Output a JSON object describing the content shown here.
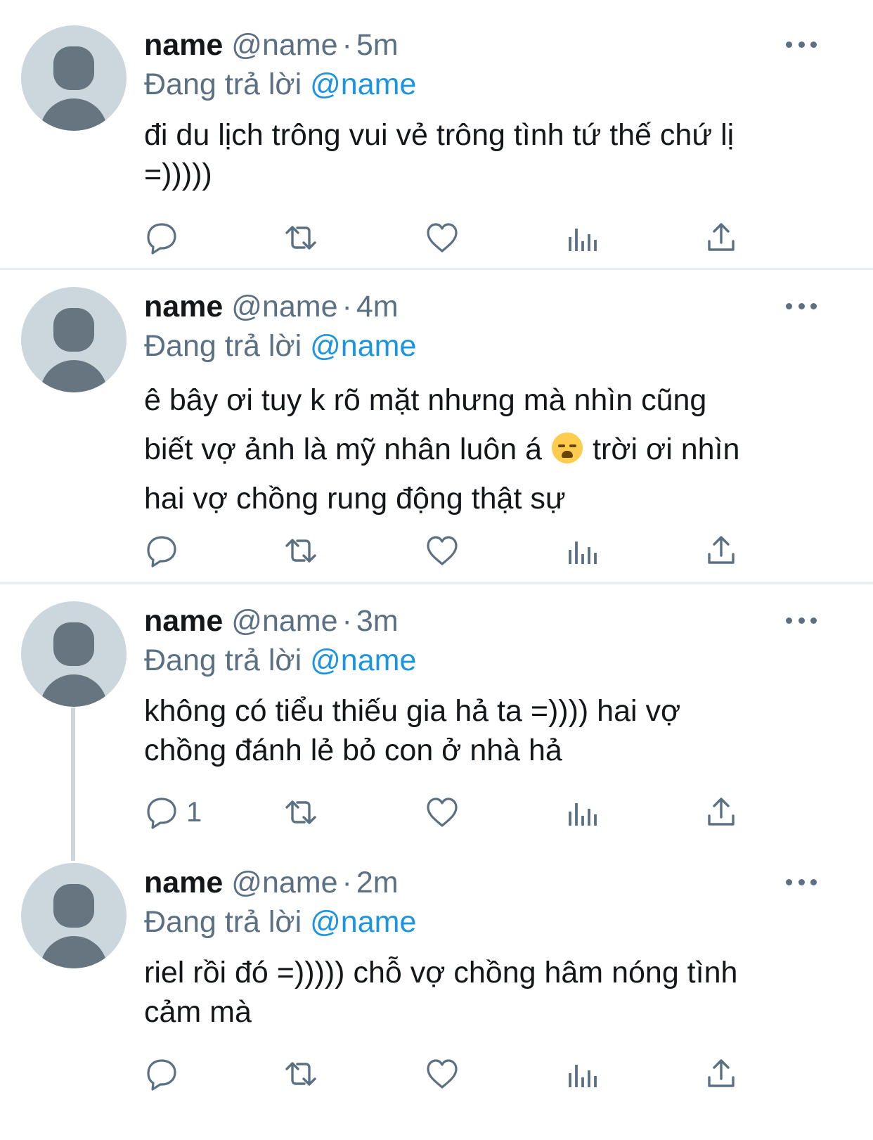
{
  "tweets": [
    {
      "name": "name",
      "handle": "@name",
      "separator": "·",
      "time": "5m",
      "replying_prefix": "Đang trả lời",
      "replying_to": "@name",
      "lines": [
        "đi du lịch trông vui vẻ trông tình tứ thế chứ lị",
        "=)))))"
      ],
      "reply_count": ""
    },
    {
      "name": "name",
      "handle": "@name",
      "separator": "·",
      "time": "4m",
      "replying_prefix": "Đang trả lời",
      "replying_to": "@name",
      "lines": [
        "ê bây ơi tuy k rõ mặt nhưng mà nhìn cũng",
        "biết vợ ảnh là mỹ nhân luôn á",
        "trời ơi nhìn",
        "hai vợ chồng rung động thật sự"
      ],
      "emoji": "loudly-crying-face-emoji",
      "reply_count": ""
    },
    {
      "name": "name",
      "handle": "@name",
      "separator": "·",
      "time": "3m",
      "replying_prefix": "Đang trả lời",
      "replying_to": "@name",
      "lines": [
        "không có tiểu thiếu gia hả ta =)))) hai vợ",
        "chồng đánh lẻ bỏ con ở nhà hả"
      ],
      "reply_count": "1"
    },
    {
      "name": "name",
      "handle": "@name",
      "separator": "·",
      "time": "2m",
      "replying_prefix": "Đang trả lời",
      "replying_to": "@name",
      "lines": [
        "riel rồi đó =))))) chỗ vợ chồng hâm nóng tình",
        "cảm mà"
      ],
      "reply_count": ""
    }
  ],
  "icons": {
    "reply": "reply-icon",
    "retweet": "retweet-icon",
    "like": "heart-icon",
    "analytics": "analytics-icon",
    "share": "share-icon",
    "more": "more-icon"
  },
  "colors": {
    "text": "#14171a",
    "secondary": "#5b7083",
    "mention": "#1b95e0",
    "divider": "#e6ecf0",
    "avatar_bg": "#ccd6dd",
    "avatar_fg": "#66757f"
  }
}
